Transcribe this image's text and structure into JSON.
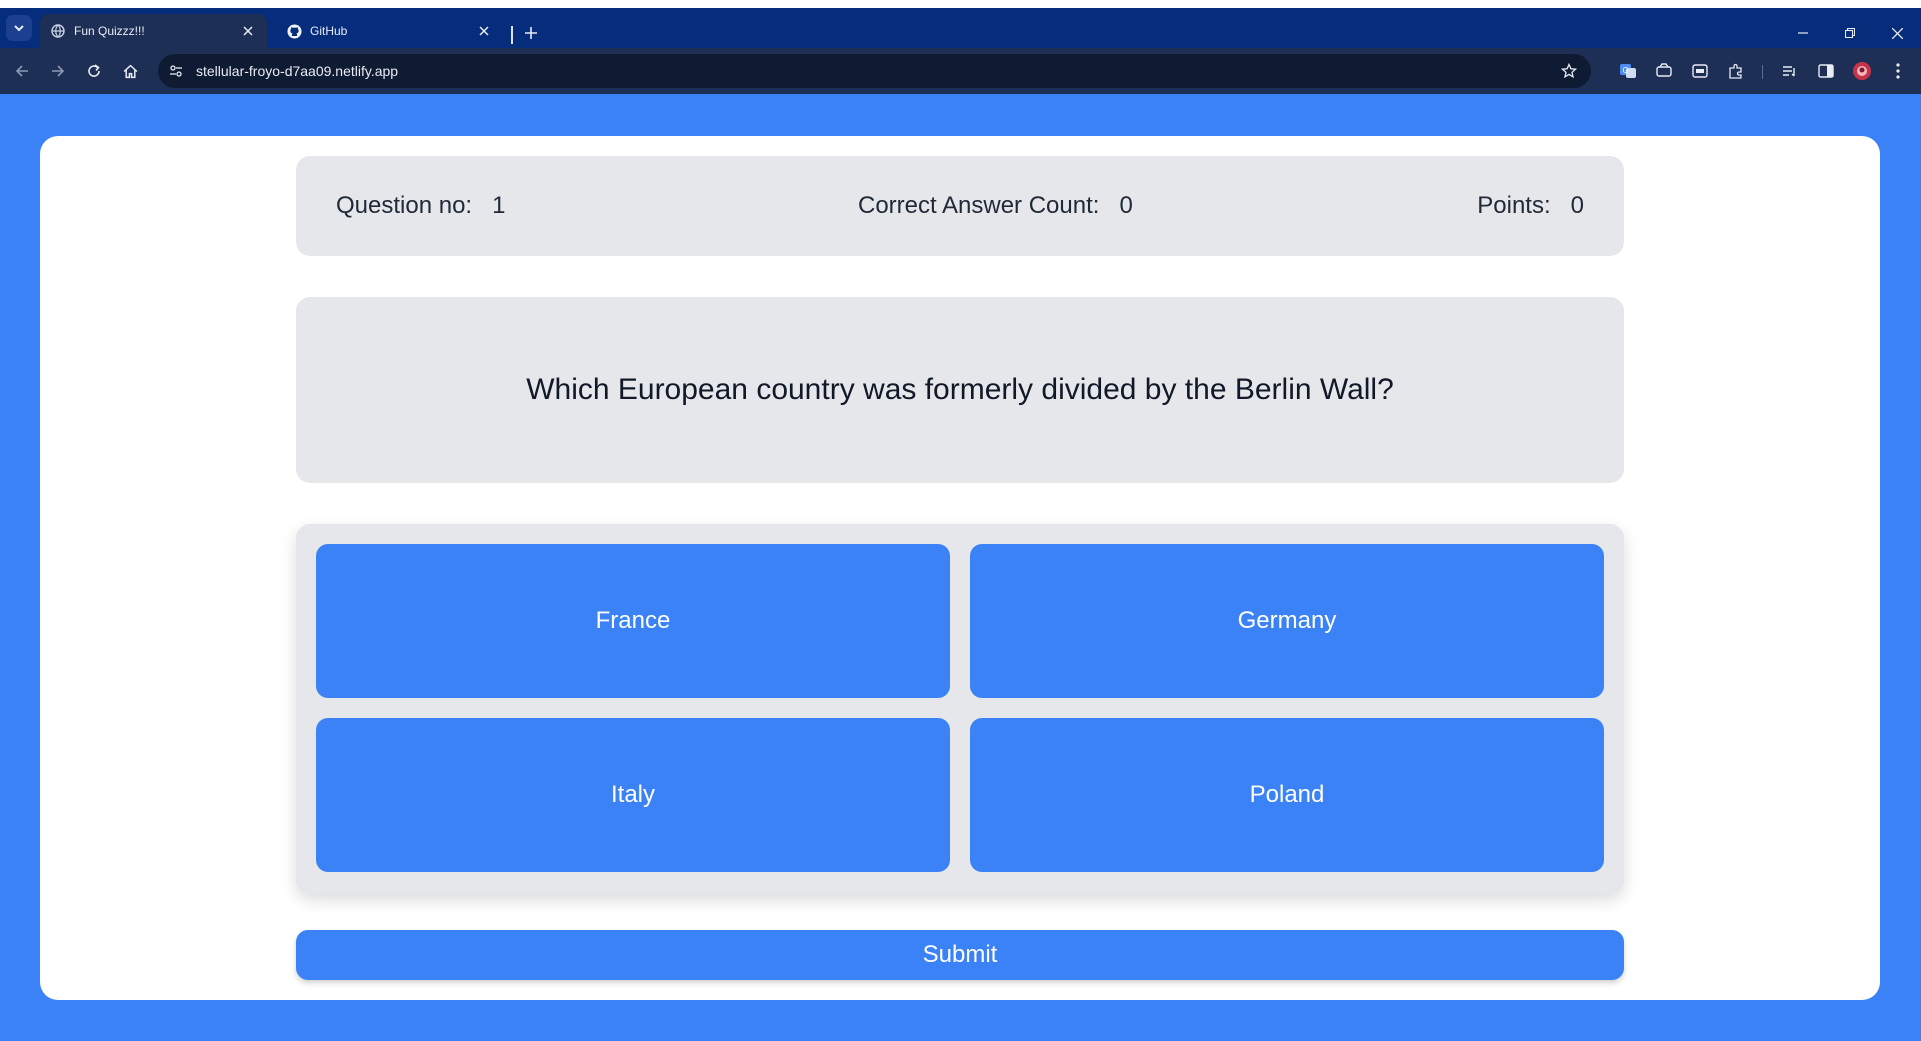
{
  "browser": {
    "tabs": [
      {
        "title": "Fun Quizzz!!!",
        "icon": "globe-icon",
        "active": true
      },
      {
        "title": "GitHub",
        "icon": "github-icon",
        "active": false
      }
    ],
    "url": "stellular-froyo-d7aa09.netlify.app"
  },
  "quiz": {
    "question_no_label": "Question no:",
    "question_no": "1",
    "correct_label": "Correct Answer Count:",
    "correct_count": "0",
    "points_label": "Points:",
    "points": "0",
    "question": "Which European country was formerly divided by the Berlin Wall?",
    "options": [
      "France",
      "Germany",
      "Italy",
      "Poland"
    ],
    "submit_label": "Submit"
  },
  "colors": {
    "page_background": "#3b82f6",
    "panel": "#e5e7eb",
    "button": "#3b82f6",
    "tab_strip": "#062c7c",
    "toolbar": "#1e2f55"
  }
}
